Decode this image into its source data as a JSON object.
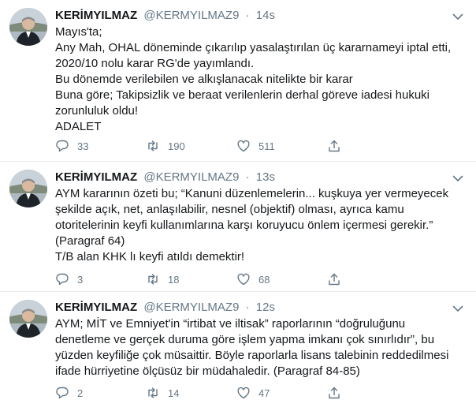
{
  "tweets": [
    {
      "name": "KERİMYILMAZ",
      "handle": "@KERMYILMAZ9",
      "separator": "·",
      "time": "14s",
      "lines": [
        "Mayıs'ta;",
        "Any Mah, OHAL döneminde çıkarılıp yasalaştırılan üç kararnameyi iptal etti,",
        "2020/10 nolu karar RG'de yayımlandı.",
        "Bu dönemde verilebilen ve alkışlanacak nitelikte bir karar",
        "Buna göre; Takipsizlik ve beraat verilenlerin derhal göreve iadesi hukuki",
        "zorunluluk oldu!",
        "ADALET"
      ],
      "replies": "33",
      "retweets": "190",
      "likes": "511"
    },
    {
      "name": "KERİMYILMAZ",
      "handle": "@KERMYILMAZ9",
      "separator": "·",
      "time": "13s",
      "lines": [
        "AYM kararının özeti bu; “Kanuni düzenlemelerin... kuşkuya yer vermeyecek",
        "şekilde açık, net, anlaşılabilir, nesnel (objektif) olması, ayrıca kamu",
        "otoritelerinin keyfi kullanımlarına karşı koruyucu önlem içermesi gerekir.”",
        "(Paragraf 64)",
        "T/B alan KHK lı keyfi atıldı demektir!"
      ],
      "replies": "3",
      "retweets": "18",
      "likes": "68"
    },
    {
      "name": "KERİMYILMAZ",
      "handle": "@KERMYILMAZ9",
      "separator": "·",
      "time": "12s",
      "lines": [
        "AYM; MİT ve Emniyet'in “irtibat ve iltisak” raporlarının “doğruluğunu",
        "denetleme ve gerçek duruma göre işlem yapma imkanı çok sınırlıdır”, bu",
        "yüzden keyfiliğe çok müsaittir. Böyle raporlarla lisans talebinin reddedilmesi",
        "ifade hürriyetine ölçüsüz bir müdahaledir. (Paragraf 84-85)"
      ],
      "replies": "2",
      "retweets": "14",
      "likes": "47"
    }
  ],
  "icons": {
    "reply": "reply-icon",
    "retweet": "retweet-icon",
    "like": "like-icon",
    "share": "share-icon",
    "more": "chevron-down-icon"
  },
  "colors": {
    "text": "#14171a",
    "secondary": "#657786",
    "divider": "#e6ecf0",
    "background": "#ffffff"
  }
}
